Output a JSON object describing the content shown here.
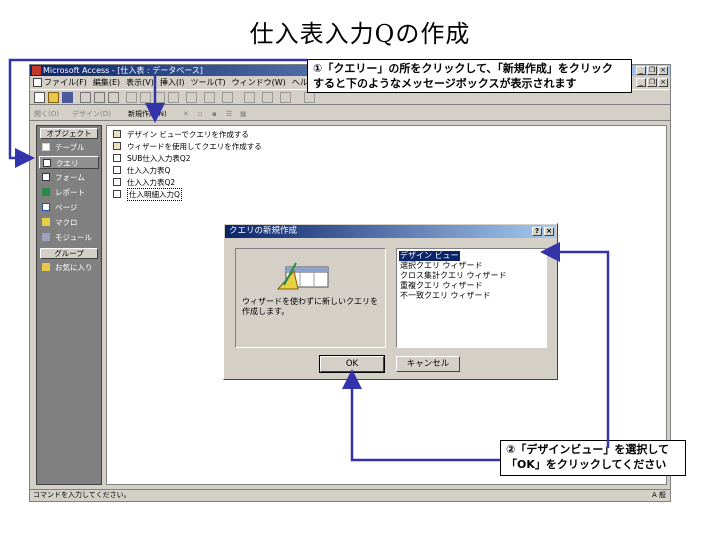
{
  "slide": {
    "title": "仕入表入力Qの作成"
  },
  "window": {
    "title": "Microsoft Access - [仕入表 : データベース]"
  },
  "menu": [
    "ファイル(F)",
    "編集(E)",
    "表示(V)",
    "挿入(I)",
    "ツール(T)",
    "ウィンドウ(W)",
    "ヘルプ(H)"
  ],
  "db_toolbar": {
    "open": "開く(O)",
    "design": "デザイン(D)",
    "new": "新規作成(N)"
  },
  "objects": {
    "header": "オブジェクト",
    "items": [
      "テーブル",
      "クエリ",
      "フォーム",
      "レポート",
      "ページ",
      "マクロ",
      "モジュール"
    ],
    "groups_header": "グループ",
    "favorites": "お気に入り"
  },
  "queries": [
    "デザイン ビューでクエリを作成する",
    "ウィザードを使用してクエリを作成する",
    "SUB仕入入力表Q2",
    "仕入入力表Q",
    "仕入入力表Q2",
    "仕入明細入力Q"
  ],
  "status": {
    "text": "コマンドを入力してください。",
    "tray": "A 般"
  },
  "dialog": {
    "title": "クエリの新規作成",
    "description": "ウィザードを使わずに新しいクエリを作成します。",
    "options": [
      "デザイン ビュー",
      "選択クエリ ウィザード",
      "クロス集計クエリ ウィザード",
      "重複クエリ ウィザード",
      "不一致クエリ ウィザード"
    ],
    "ok": "OK",
    "cancel": "キャンセル"
  },
  "callouts": {
    "step1_line1": "①「クエリー」の所をクリックして、「新規作成」をクリック",
    "step1_line2": "すると下のようなメッセージボックスが表示されます",
    "step2_line1": "②「デザインビュー」を選択して",
    "step2_line2": "「OK」をクリックしてください"
  },
  "colors": {
    "titlebar": "#0a246a",
    "arrow": "#3333aa",
    "face": "#d4d0c8"
  }
}
